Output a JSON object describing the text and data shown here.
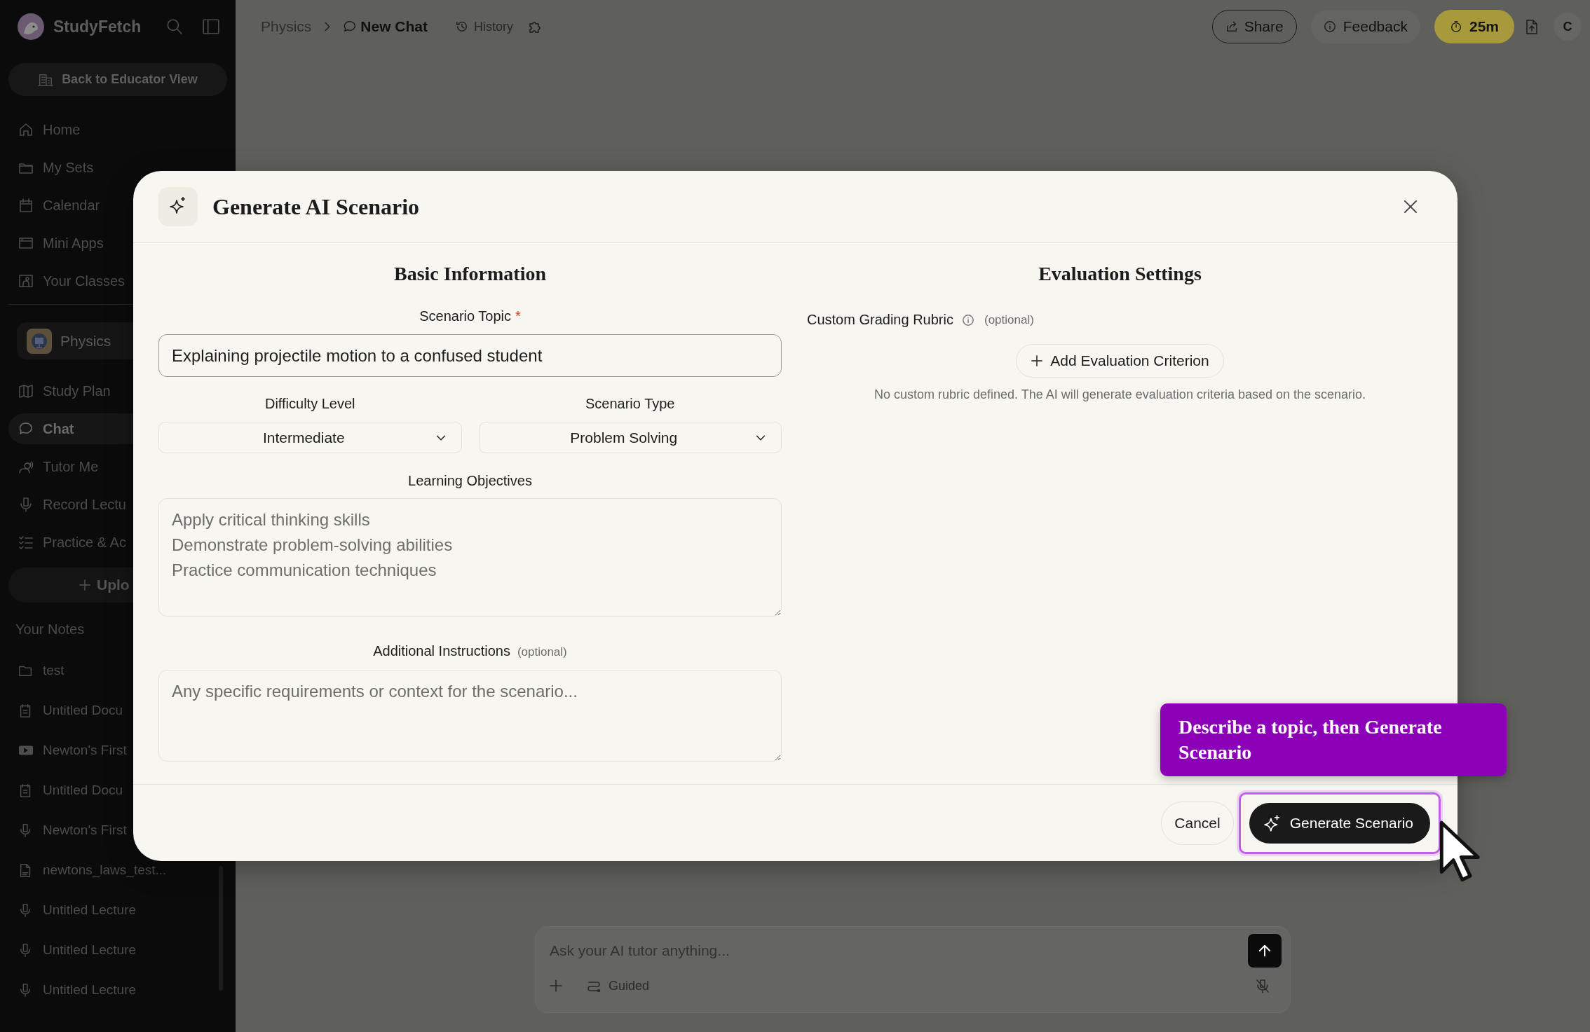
{
  "sidebar": {
    "brand": "StudyFetch",
    "back_button": "Back to Educator View",
    "nav": [
      {
        "label": "Home",
        "selected": false
      },
      {
        "label": "My Sets",
        "selected": false
      },
      {
        "label": "Calendar",
        "selected": false
      },
      {
        "label": "Mini Apps",
        "selected": false
      },
      {
        "label": "Your Classes",
        "selected": false
      }
    ],
    "class_chip": "Physics",
    "class_nav": [
      {
        "label": "Study Plan",
        "selected": false
      },
      {
        "label": "Chat",
        "selected": true
      },
      {
        "label": "Tutor Me",
        "selected": false
      },
      {
        "label": "Record Lectu",
        "selected": false
      },
      {
        "label": "Practice & Ac",
        "selected": false
      }
    ],
    "upload_button": "Uplo",
    "notes_heading": "Your Notes",
    "notes": [
      {
        "kind": "folder",
        "label": "test"
      },
      {
        "kind": "document",
        "label": "Untitled Docu"
      },
      {
        "kind": "video",
        "label": "Newton's First"
      },
      {
        "kind": "document",
        "label": "Untitled Docu"
      },
      {
        "kind": "audio",
        "label": "Newton's First"
      },
      {
        "kind": "pdf",
        "label": "newtons_laws_test..."
      },
      {
        "kind": "audio",
        "label": "Untitled Lecture"
      },
      {
        "kind": "audio",
        "label": "Untitled Lecture"
      },
      {
        "kind": "audio",
        "label": "Untitled Lecture"
      }
    ]
  },
  "topbar": {
    "breadcrumb": [
      "Physics",
      "New Chat"
    ],
    "history": "History",
    "share": "Share",
    "feedback": "Feedback",
    "timer": "25m",
    "avatar": "C"
  },
  "dialog": {
    "title": "Generate AI Scenario",
    "basic": {
      "heading": "Basic Information",
      "topic": {
        "label": "Scenario Topic",
        "required_mark": "*",
        "value": "Explaining projectile motion to a confused student"
      },
      "difficulty": {
        "label": "Difficulty Level",
        "value": "Intermediate"
      },
      "type": {
        "label": "Scenario Type",
        "value": "Problem Solving"
      },
      "objectives": {
        "label": "Learning Objectives",
        "placeholder": "Apply critical thinking skills\nDemonstrate problem-solving abilities\nPractice communication techniques"
      },
      "instructions": {
        "label": "Additional Instructions",
        "hint": "(optional)",
        "placeholder": "Any specific requirements or context for the scenario..."
      }
    },
    "evaluation": {
      "heading": "Evaluation Settings",
      "rubric_label": "Custom Grading Rubric",
      "hint": "(optional)",
      "add_button": "Add Evaluation Criterion",
      "note": "No custom rubric defined. The AI will generate evaluation criteria based on the scenario."
    },
    "cancel": "Cancel",
    "generate": {
      "label": "Generate Scenario",
      "highlighted": true
    }
  },
  "tooltip": "Describe a topic, then Generate Scenario",
  "chat": {
    "placeholder": "Ask your AI tutor anything...",
    "mode": "Guided"
  }
}
